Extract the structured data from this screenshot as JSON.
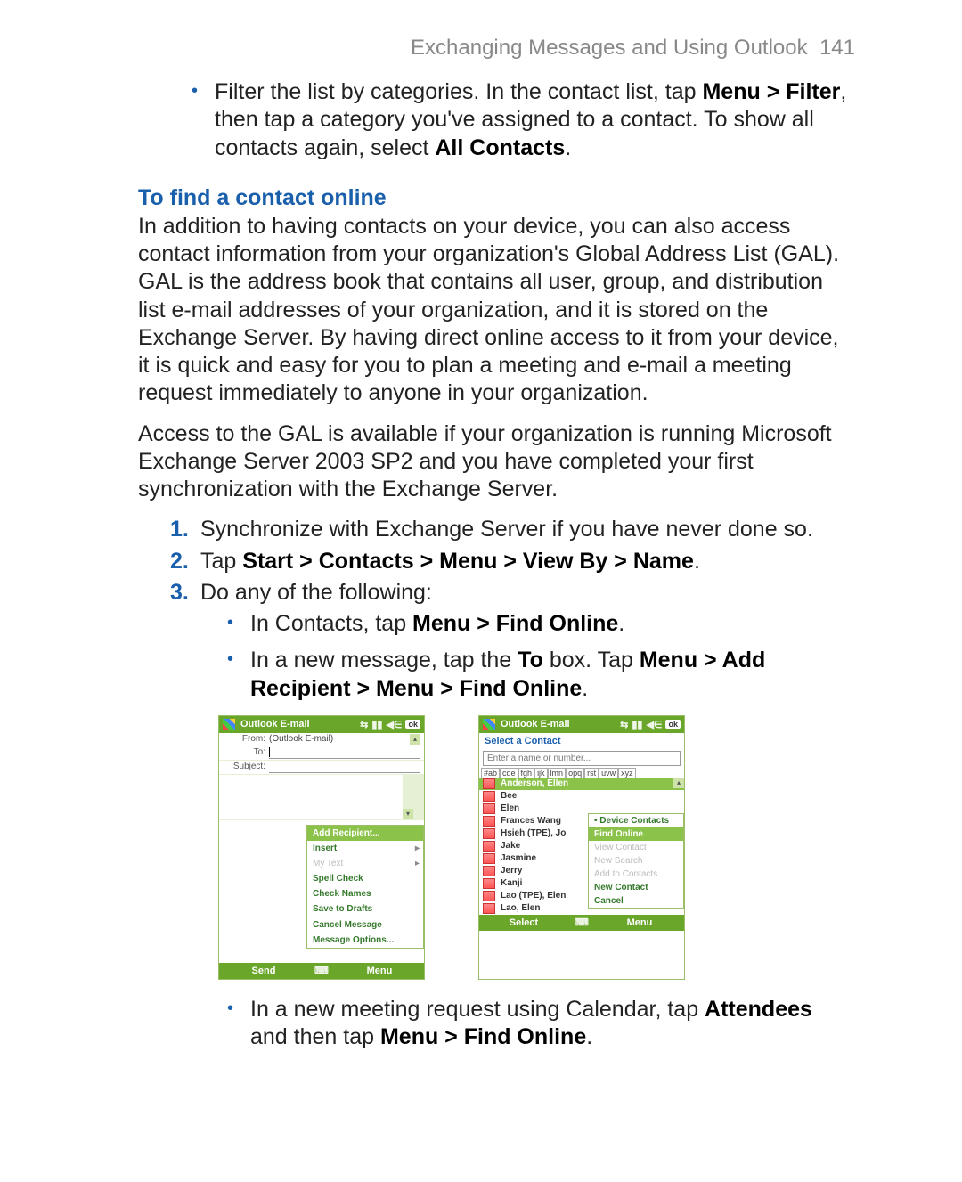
{
  "header": {
    "title": "Exchanging Messages and Using Outlook",
    "page_number": "141"
  },
  "intro_bullet": {
    "pre": "Filter the list by categories. In the contact list, tap ",
    "b1": "Menu > Filter",
    "mid": ", then tap a category you've assigned to a contact. To show all contacts again, select ",
    "b2": "All Contacts",
    "post": "."
  },
  "section": {
    "heading": "To find a contact online"
  },
  "para1": "In addition to having contacts on your device, you can also access contact information from your organization's Global Address List (GAL). GAL is the address book that contains all user, group, and distribution list e-mail addresses of your organization, and it is stored on the Exchange Server. By having direct online access to it from your device, it is quick and easy for you to plan a meeting and e-mail a meeting request immediately to anyone in your organization.",
  "para2": "Access to the GAL is available if your organization is running Microsoft Exchange Server 2003 SP2 and you have completed your first synchronization with the Exchange Server.",
  "steps": {
    "s1": "Synchronize with Exchange Server if you have never done so.",
    "s2_pre": "Tap ",
    "s2_b": "Start > Contacts > Menu > View By > Name",
    "s2_post": ".",
    "s3": "Do any of the following:"
  },
  "sub": {
    "a_pre": "In Contacts, tap ",
    "a_b": "Menu > Find Online",
    "a_post": ".",
    "b_pre": "In a new message, tap the ",
    "b_b1": "To",
    "b_mid": " box. Tap ",
    "b_b2": "Menu > Add Recipient > Menu > Find Online",
    "b_post": ".",
    "c_pre": "In a new meeting request using Calendar, tap ",
    "c_b1": "Attendees",
    "c_mid": " and then tap ",
    "c_b2": "Menu > Find Online",
    "c_post": "."
  },
  "shot1": {
    "title": "Outlook E-mail",
    "ok": "ok",
    "from_label": "From:",
    "from_value": "(Outlook E-mail)",
    "to_label": "To:",
    "subject_label": "Subject:",
    "menu": {
      "add_recipient": "Add Recipient...",
      "insert": "Insert",
      "my_text": "My Text",
      "spell_check": "Spell Check",
      "check_names": "Check Names",
      "save_drafts": "Save to Drafts",
      "cancel_message": "Cancel Message",
      "message_options": "Message Options..."
    },
    "soft_left": "Send",
    "soft_right": "Menu"
  },
  "shot2": {
    "title": "Outlook E-mail",
    "ok": "ok",
    "subtitle": "Select a Contact",
    "placeholder": "Enter a name or number...",
    "tabs": [
      "#ab",
      "cde",
      "fgh",
      "ijk",
      "lmn",
      "opq",
      "rst",
      "uvw",
      "xyz"
    ],
    "contacts": [
      "Anderson, Ellen",
      "Bee",
      "Elen",
      "Frances Wang",
      "Hsieh (TPE), Jo",
      "Jake",
      "Jasmine",
      "Jerry",
      "Kanji",
      "Lao (TPE), Elen",
      "Lao, Elen"
    ],
    "menu": {
      "device_contacts": "Device Contacts",
      "find_online": "Find Online",
      "view_contact": "View Contact",
      "new_search": "New Search",
      "add_to_contacts": "Add to Contacts",
      "new_contact": "New Contact",
      "cancel": "Cancel"
    },
    "soft_left": "Select",
    "soft_right": "Menu"
  }
}
